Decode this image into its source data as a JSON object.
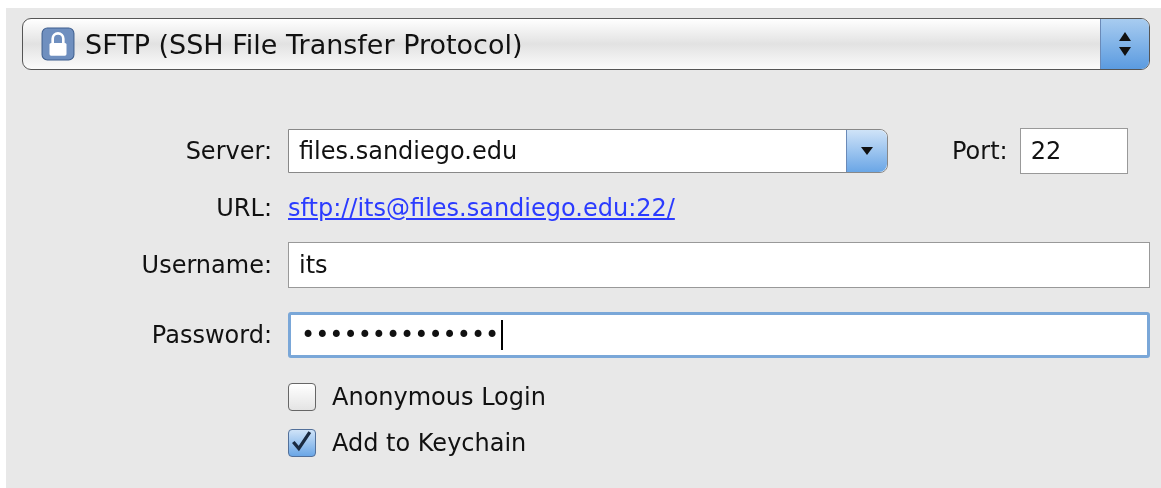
{
  "protocol": {
    "label": "SFTP (SSH File Transfer Protocol)"
  },
  "server": {
    "label": "Server:",
    "value": "files.sandiego.edu"
  },
  "port": {
    "label": "Port:",
    "value": "22"
  },
  "url": {
    "label": "URL:",
    "link": "sftp://its@files.sandiego.edu:22/"
  },
  "username": {
    "label": "Username:",
    "value": "its"
  },
  "password": {
    "label": "Password:",
    "value": "••••••••••••••",
    "focused": true
  },
  "options": [
    {
      "label": "Anonymous Login",
      "checked": false
    },
    {
      "label": "Add to Keychain",
      "checked": true
    }
  ]
}
